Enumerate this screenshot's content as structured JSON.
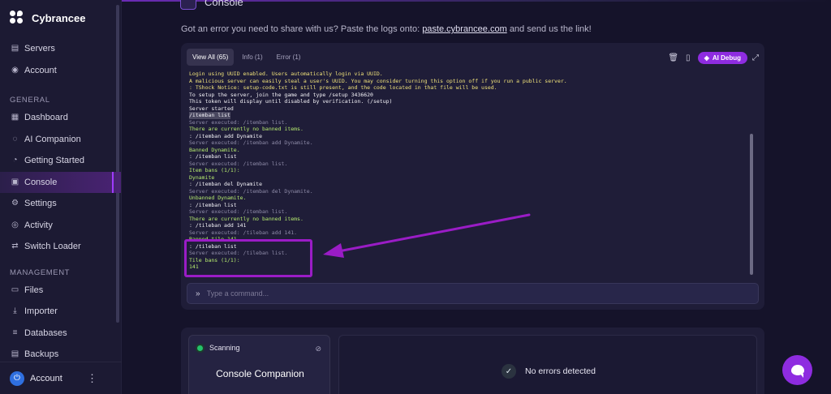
{
  "brand": {
    "name": "Cybrancee"
  },
  "sidebar": {
    "top_items": [
      {
        "label": "Servers",
        "icon": "server-icon"
      },
      {
        "label": "Account",
        "icon": "account-icon"
      }
    ],
    "section_general": "GENERAL",
    "general_items": [
      {
        "label": "Dashboard",
        "icon": "dashboard-icon"
      },
      {
        "label": "AI Companion",
        "icon": "ai-chat-icon"
      },
      {
        "label": "Getting Started",
        "icon": "compass-icon"
      },
      {
        "label": "Console",
        "icon": "terminal-icon",
        "active": true
      },
      {
        "label": "Settings",
        "icon": "gear-icon"
      },
      {
        "label": "Activity",
        "icon": "eye-icon"
      },
      {
        "label": "Switch Loader",
        "icon": "switch-icon"
      }
    ],
    "section_management": "MANAGEMENT",
    "management_items": [
      {
        "label": "Files",
        "icon": "folder-icon"
      },
      {
        "label": "Importer",
        "icon": "download-icon"
      },
      {
        "label": "Databases",
        "icon": "database-icon"
      },
      {
        "label": "Backups",
        "icon": "archive-icon"
      }
    ],
    "account": {
      "label": "Account",
      "icon": "power-icon"
    }
  },
  "page": {
    "title": "Console",
    "notice_prefix": "Got an error you need to share with us? Paste the logs onto:",
    "notice_link": "paste.cybrancee.com",
    "notice_suffix": "and send us the link!"
  },
  "console": {
    "tabs": [
      "View All (65)",
      "Info (1)",
      "Error (1)"
    ],
    "ai_debug": "AI Debug",
    "command_placeholder": "Type a command...",
    "lines": [
      {
        "t": "Login using UUID enabled. Users automatically login via UUID.",
        "c": "y"
      },
      {
        "t": "A malicious server can easily steal a user's UUID. You may consider turning this option off if you run a public server.",
        "c": "y"
      },
      {
        "t": ": TShock Notice: setup-code.txt is still present, and the code located in that file will be used.",
        "c": "y"
      },
      {
        "t": "To setup the server, join the game and type /setup 3436620",
        "c": "w"
      },
      {
        "t": "This token will display until disabled by verification. (/setup)",
        "c": "w"
      },
      {
        "t": "Server started",
        "c": "w"
      },
      {
        "t": "/itemban list",
        "c": "hl"
      },
      {
        "t": "Server executed: /itemban list.",
        "c": "d"
      },
      {
        "t": "There are currently no banned items.",
        "c": "g"
      },
      {
        "t": ": /itemban add Dynamite",
        "c": "w"
      },
      {
        "t": "Server executed: /itemban add Dynamite.",
        "c": "d"
      },
      {
        "t": "Banned Dynamite.",
        "c": "g"
      },
      {
        "t": ": /itemban list",
        "c": "w"
      },
      {
        "t": "Server executed: /itemban list.",
        "c": "d"
      },
      {
        "t": "Item bans (1/1):",
        "c": "g"
      },
      {
        "t": "Dynamite",
        "c": "g"
      },
      {
        "t": ": /itemban del Dynamite",
        "c": "w"
      },
      {
        "t": "Server executed: /itemban del Dynamite.",
        "c": "d"
      },
      {
        "t": "Unbanned Dynamite.",
        "c": "g"
      },
      {
        "t": ": /itemban list",
        "c": "w"
      },
      {
        "t": "Server executed: /itemban list.",
        "c": "d"
      },
      {
        "t": "There are currently no banned items.",
        "c": "g"
      },
      {
        "t": ": /tileban add 141",
        "c": "w"
      },
      {
        "t": "Server executed: /tileban add 141.",
        "c": "d"
      },
      {
        "t": "Banned tile 141.",
        "c": "g"
      },
      {
        "t": ": /tileban list",
        "c": "w"
      },
      {
        "t": "Server executed: /tileban list.",
        "c": "d"
      },
      {
        "t": "Tile bans (1/1):",
        "c": "g"
      },
      {
        "t": "141",
        "c": "g"
      }
    ]
  },
  "companion": {
    "status": "Scanning",
    "title": "Console Companion",
    "result": "No errors detected"
  },
  "colors": {
    "accent": "#8e2ce0",
    "highlight_box": "#9a1cc6"
  }
}
